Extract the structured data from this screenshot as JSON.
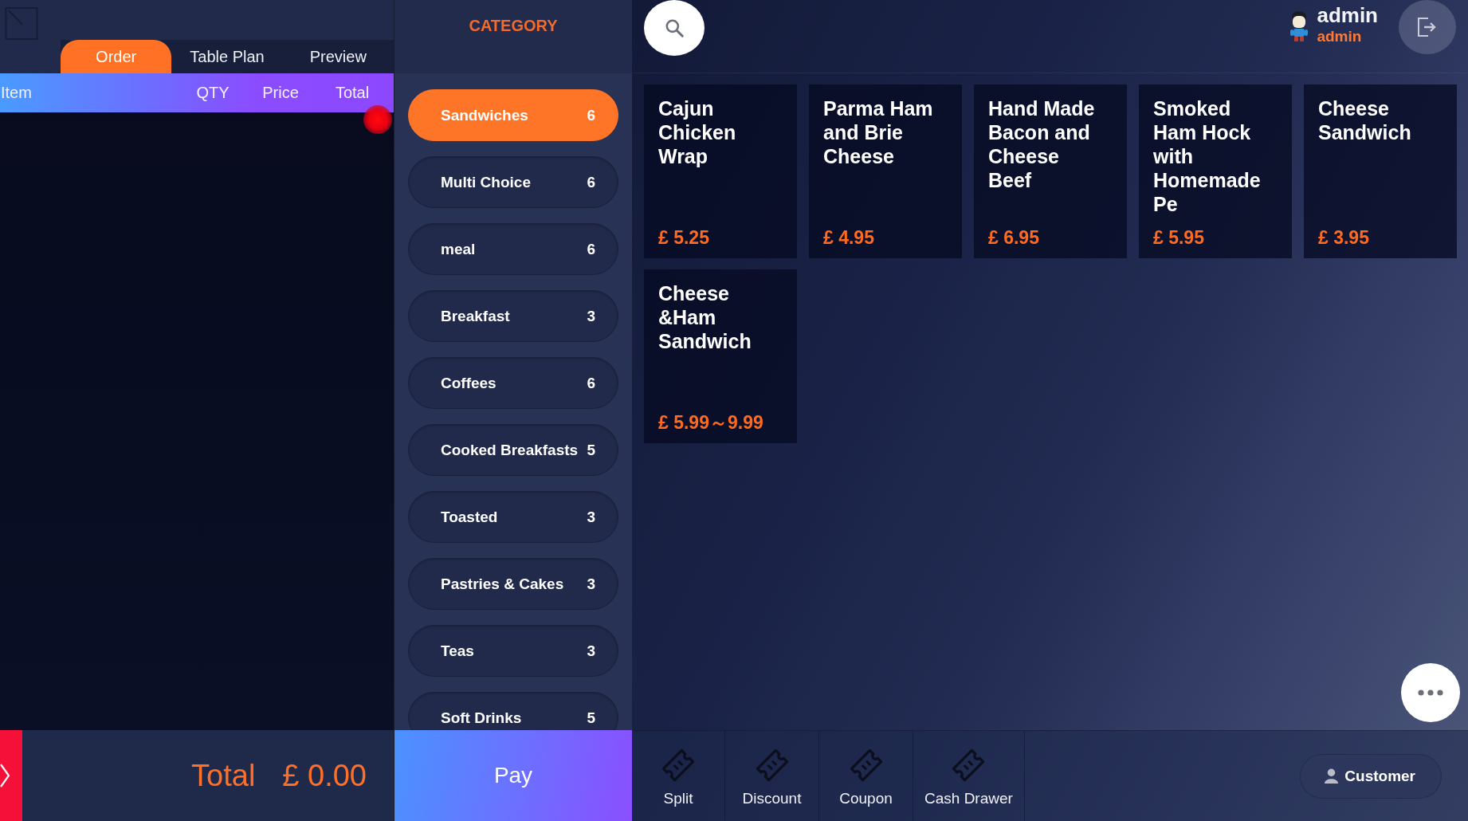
{
  "toolbar": {
    "tabs": [
      {
        "label": "Order",
        "selected": true
      },
      {
        "label": "Table Plan",
        "selected": false
      },
      {
        "label": "Preview",
        "selected": false
      }
    ]
  },
  "order_table": {
    "columns": [
      "Item",
      "QTY",
      "Price",
      "Total"
    ]
  },
  "order_footer": {
    "total_label": "Total",
    "total_value": "£ 0.00"
  },
  "category": {
    "title": "CATEGORY",
    "items": [
      {
        "name": "Sandwiches",
        "count": "6",
        "selected": true
      },
      {
        "name": "Multi Choice",
        "count": "6",
        "selected": false
      },
      {
        "name": "meal",
        "count": "6",
        "selected": false
      },
      {
        "name": "Breakfast",
        "count": "3",
        "selected": false
      },
      {
        "name": "Coffees",
        "count": "6",
        "selected": false
      },
      {
        "name": "Cooked Breakfasts",
        "count": "5",
        "selected": false
      },
      {
        "name": "Toasted",
        "count": "3",
        "selected": false
      },
      {
        "name": "Pastries & Cakes",
        "count": "3",
        "selected": false
      },
      {
        "name": "Teas",
        "count": "3",
        "selected": false
      },
      {
        "name": "Soft Drinks",
        "count": "5",
        "selected": false
      }
    ]
  },
  "pay_button": "Pay",
  "user": {
    "name": "admin",
    "role": "admin"
  },
  "products": [
    {
      "name": "Cajun Chicken Wrap",
      "price": "£ 5.25"
    },
    {
      "name": "Parma Ham and Brie Cheese",
      "price": "£ 4.95"
    },
    {
      "name": "Hand Made Bacon and Cheese Beef",
      "price": "£ 6.95"
    },
    {
      "name": "Smoked Ham Hock with Homemade Pe",
      "price": "£ 5.95"
    },
    {
      "name": "Cheese Sandwich",
      "price": "£ 3.95"
    },
    {
      "name": "Cheese &Ham Sandwich",
      "price": "£ 5.99～9.99"
    }
  ],
  "actions": [
    "Split",
    "Discount",
    "Coupon",
    "Cash Drawer"
  ],
  "customer_button": "Customer"
}
